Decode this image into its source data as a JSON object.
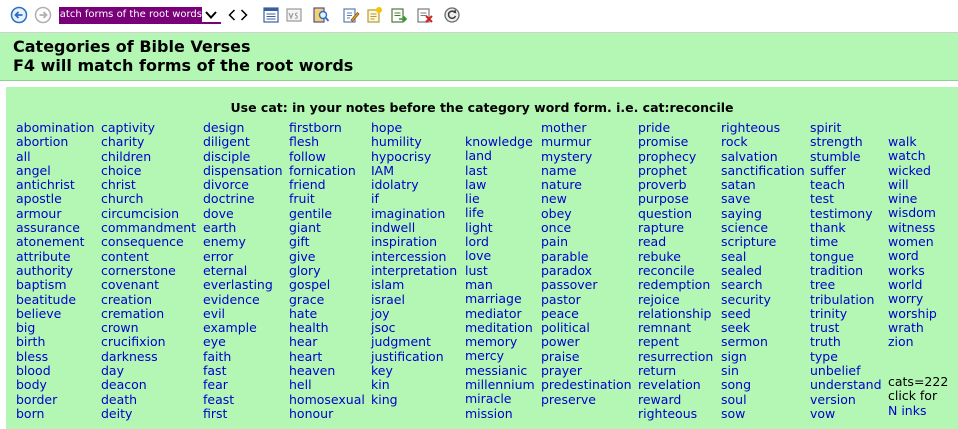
{
  "toolbar": {
    "search_value": "Match forms of the root words",
    "icons": [
      "back-circle-icon",
      "forward-circle-icon",
      "dropdown-arrow-icon",
      "nav-left-icon",
      "nav-right-icon",
      "document-list-icon",
      "verse-view-icon",
      "book-search-icon",
      "edit-note-icon",
      "new-note-icon",
      "export-note-icon",
      "delete-note-icon",
      "refresh-icon"
    ]
  },
  "header": {
    "title": "Categories of Bible Verses",
    "subtitle": "F4 will match forms of the root words"
  },
  "content": {
    "instruction": "Use cat: in your notes before the category word form. i.e. cat:reconcile",
    "columns": [
      [
        "abomination",
        "abortion",
        "all",
        "angel",
        "antichrist",
        "apostle",
        "armour",
        "assurance",
        "atonement",
        "attribute",
        "authority",
        "baptism",
        "beatitude",
        "believe",
        "big",
        "birth",
        "bless",
        "blood",
        "body",
        "border",
        "born"
      ],
      [
        "captivity",
        "charity",
        "children",
        "choice",
        "christ",
        "church",
        "circumcision",
        "commandment",
        "consequence",
        "content",
        "cornerstone",
        "covenant",
        "creation",
        "cremation",
        "crown",
        "crucifixion",
        "darkness",
        "day",
        "deacon",
        "death",
        "deity"
      ],
      [
        "design",
        "diligent",
        "disciple",
        "dispensation",
        "divorce",
        "doctrine",
        "dove",
        "earth",
        "enemy",
        "error",
        "eternal",
        "everlasting",
        "evidence",
        "evil",
        "example",
        "eye",
        "faith",
        "fast",
        "fear",
        "feast",
        "first"
      ],
      [
        "firstborn",
        "flesh",
        "follow",
        "fornication",
        "friend",
        "fruit",
        "gentile",
        "giant",
        "gift",
        "give",
        "glory",
        "gospel",
        "grace",
        "hate",
        "health",
        "hear",
        "heart",
        "heaven",
        "hell",
        "homosexual",
        "honour"
      ],
      [
        "hope",
        "humility",
        "hypocrisy",
        "IAM",
        "idolatry",
        "if",
        "imagination",
        "indwell",
        "inspiration",
        "intercession",
        "interpretation",
        "islam",
        "israel",
        "joy",
        "jsoc",
        "judgment",
        "justification",
        "key",
        "kin",
        "king"
      ],
      [
        "knowledge",
        "land",
        "last",
        "law",
        "lie",
        "life",
        "light",
        "lord",
        "love",
        "lust",
        "man",
        "marriage",
        "mediator",
        "meditation",
        "memory",
        "mercy",
        "messianic",
        "millennium",
        "miracle",
        "mission"
      ],
      [
        "mother",
        "murmur",
        "mystery",
        "name",
        "nature",
        "new",
        "obey",
        "once",
        "pain",
        "parable",
        "paradox",
        "passover",
        "pastor",
        "peace",
        "political",
        "power",
        "praise",
        "prayer",
        "predestination",
        "preserve"
      ],
      [
        "pride",
        "promise",
        "prophecy",
        "prophet",
        "proverb",
        "purpose",
        "question",
        "rapture",
        "read",
        "rebuke",
        "reconcile",
        "redemption",
        "rejoice",
        "relationship",
        "remnant",
        "repent",
        "resurrection",
        "return",
        "revelation",
        "reward",
        "righteous"
      ],
      [
        "righteous",
        "rock",
        "salvation",
        "sanctification",
        "satan",
        "save",
        "saying",
        "science",
        "scripture",
        "seal",
        "sealed",
        "search",
        "security",
        "seed",
        "seek",
        "sermon",
        "sign",
        "sin",
        "song",
        "soul",
        "sow"
      ],
      [
        "spirit",
        "strength",
        "stumble",
        "suffer",
        "teach",
        "test",
        "testimony",
        "thank",
        "time",
        "tongue",
        "tradition",
        "tree",
        "tribulation",
        "trinity",
        "trust",
        "truth",
        "type",
        "unbelief",
        "understand",
        "version",
        "vow"
      ],
      [
        "walk",
        "watch",
        "wicked",
        "will",
        "wine",
        "wisdom",
        "witness",
        "women",
        "word",
        "works",
        "world",
        "worry",
        "worship",
        "wrath",
        "zion"
      ]
    ],
    "cats_count": "cats=222",
    "cats_click": "click for",
    "cats_link": "N inks"
  }
}
